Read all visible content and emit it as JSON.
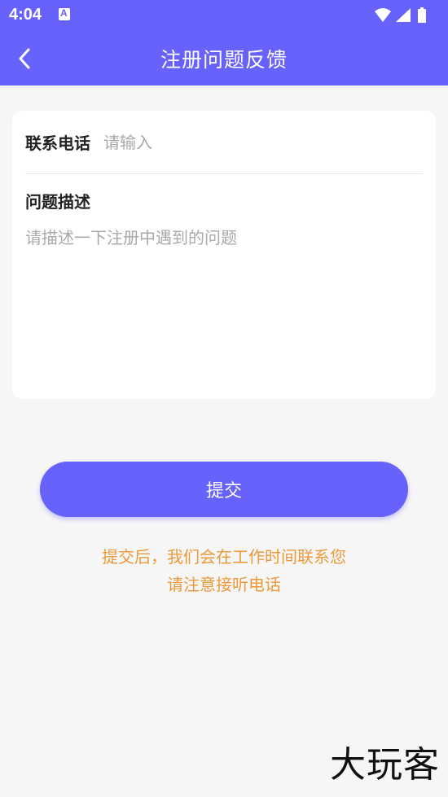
{
  "status_bar": {
    "time": "4:04",
    "notification_icon": "app-notification-icon",
    "icons": [
      "wifi-icon",
      "signal-icon",
      "battery-icon"
    ]
  },
  "header": {
    "title": "注册问题反馈",
    "back_icon": "chevron-left-icon"
  },
  "form": {
    "phone_label": "联系电话",
    "phone_placeholder": "请输入",
    "phone_value": "",
    "description_label": "问题描述",
    "description_placeholder": "请描述一下注册中遇到的问题",
    "description_value": ""
  },
  "submit_label": "提交",
  "notice": {
    "line1": "提交后，我们会在工作时间联系您",
    "line2": "请注意接听电话"
  },
  "watermark": "大玩客",
  "colors": {
    "primary": "#6762fb",
    "notice": "#eb9a3a",
    "background": "#f6f6f6"
  }
}
